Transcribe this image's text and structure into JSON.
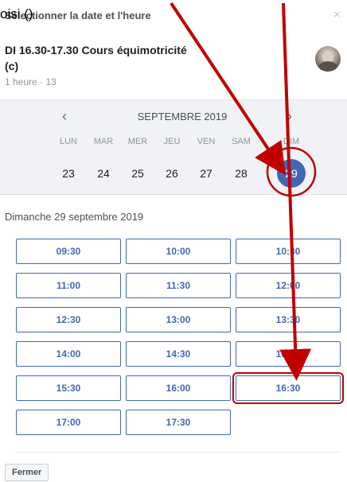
{
  "overlay": {
    "text": "oisi ()"
  },
  "header": {
    "title": "Sélectionner la date et l'heure",
    "close": "×"
  },
  "event": {
    "title": "DI 16.30-17.30 Cours équimotricité (c)",
    "meta": "1 heure · 13"
  },
  "calendar": {
    "prev": "‹",
    "next": "›",
    "month": "SEPTEMBRE 2019",
    "weekdays": [
      "LUN",
      "MAR",
      "MER",
      "JEU",
      "VEN",
      "SAM",
      "DIM"
    ],
    "days": [
      "23",
      "24",
      "25",
      "26",
      "27",
      "28",
      "29"
    ],
    "selected_index": 6
  },
  "date_heading": "Dimanche 29 septembre 2019",
  "slots": [
    "09:30",
    "10:00",
    "10:30",
    "11:00",
    "11:30",
    "12:00",
    "12:30",
    "13:00",
    "13:30",
    "14:00",
    "14:30",
    "15:00",
    "15:30",
    "16:00",
    "16:30",
    "17:00",
    "17:30"
  ],
  "highlighted_slot_index": 14,
  "footer": {
    "close_label": "Fermer"
  },
  "colors": {
    "accent": "#4267b2",
    "annotation": "#c00000",
    "calendar_bg": "#f0f2f5"
  },
  "icons": {
    "close": "close-icon",
    "prev": "chevron-left-icon",
    "next": "chevron-right-icon"
  }
}
